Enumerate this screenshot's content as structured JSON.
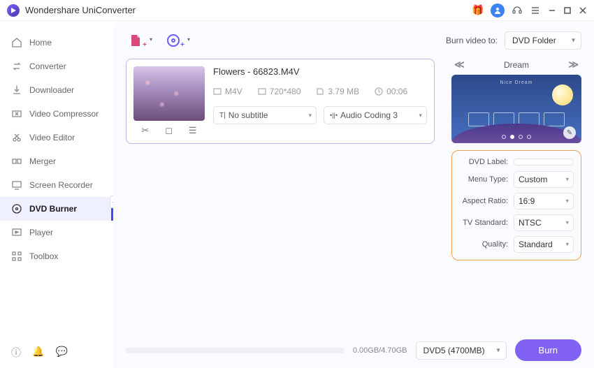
{
  "app": {
    "title": "Wondershare UniConverter"
  },
  "sidebar": {
    "items": [
      {
        "label": "Home"
      },
      {
        "label": "Converter"
      },
      {
        "label": "Downloader"
      },
      {
        "label": "Video Compressor"
      },
      {
        "label": "Video Editor"
      },
      {
        "label": "Merger"
      },
      {
        "label": "Screen Recorder"
      },
      {
        "label": "DVD Burner"
      },
      {
        "label": "Player"
      },
      {
        "label": "Toolbox"
      }
    ]
  },
  "toolbar": {
    "burn_to_label": "Burn video to:",
    "burn_target": "DVD Folder"
  },
  "video": {
    "title": "Flowers - 66823.M4V",
    "format": "M4V",
    "resolution": "720*480",
    "size": "3.79 MB",
    "duration": "00:06",
    "subtitle": "No subtitle",
    "audio": "Audio Coding 3"
  },
  "theme": {
    "name": "Dream",
    "preview_label": "Nice Dream"
  },
  "settings": {
    "labels": {
      "dvd_label": "DVD Label:",
      "menu_type": "Menu Type:",
      "aspect_ratio": "Aspect Ratio:",
      "tv_standard": "TV Standard:",
      "quality": "Quality:"
    },
    "values": {
      "dvd_label": "",
      "menu_type": "Custom",
      "aspect_ratio": "16:9",
      "tv_standard": "NTSC",
      "quality": "Standard"
    }
  },
  "footer": {
    "size_text": "0.00GB/4.70GB",
    "disc_type": "DVD5 (4700MB)",
    "burn_label": "Burn"
  }
}
